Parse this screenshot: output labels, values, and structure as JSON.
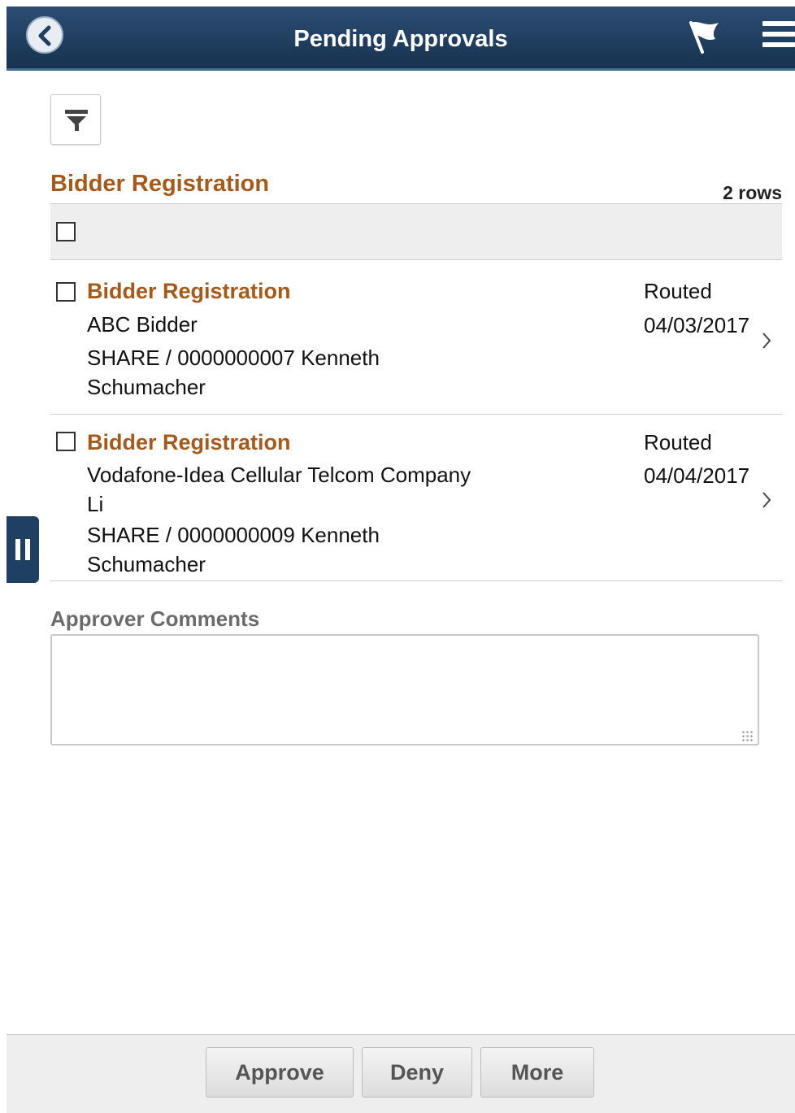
{
  "header": {
    "title": "Pending Approvals",
    "back_icon": "chevron-left-icon",
    "flag_icon": "flag-icon",
    "menu_icon": "hamburger-menu-icon"
  },
  "toolbar": {
    "filter_icon": "filter-icon"
  },
  "grid": {
    "title": "Bidder Registration",
    "row_count": "2 rows",
    "rows": [
      {
        "title": "Bidder Registration",
        "line1": "ABC Bidder",
        "line2": "SHARE / 0000000007  Kenneth",
        "line3": "Schumacher",
        "status": "Routed",
        "date": "04/03/2017"
      },
      {
        "title": "Bidder Registration",
        "line1": "Vodafone-Idea Cellular Telcom Company",
        "line1b": "Li",
        "line2": "SHARE / 0000000009  Kenneth",
        "line3": "Schumacher",
        "status": "Routed",
        "date": "04/04/2017"
      }
    ]
  },
  "comments": {
    "label": "Approver Comments",
    "value": ""
  },
  "footer": {
    "approve": "Approve",
    "deny": "Deny",
    "more": "More"
  },
  "colors": {
    "header_bg": "#1f3f63",
    "accent_title": "#a55a1b"
  }
}
